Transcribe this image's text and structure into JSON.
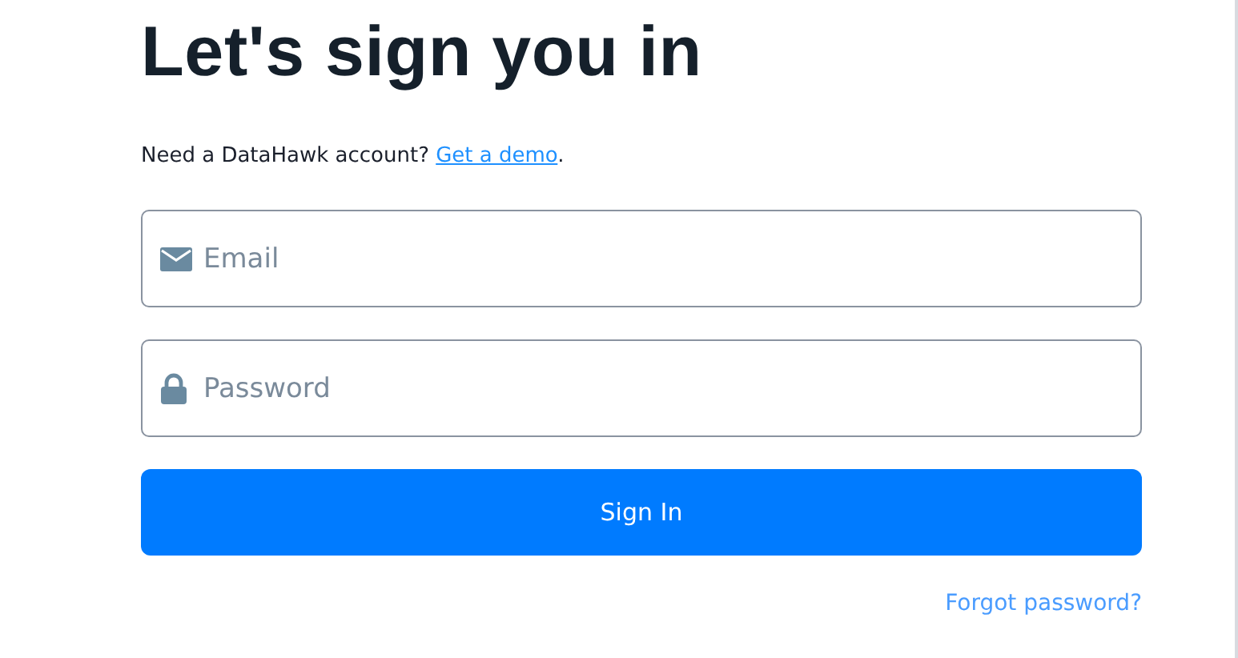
{
  "heading": "Let's sign you in",
  "prompt": {
    "text": "Need a DataHawk account?",
    "link": "Get a demo",
    "suffix": "."
  },
  "fields": [
    {
      "kind": "email",
      "placeholder": "Email"
    },
    {
      "kind": "password",
      "placeholder": "Password"
    }
  ],
  "submit": "Sign In",
  "forgot_link": "Forgot password?"
}
